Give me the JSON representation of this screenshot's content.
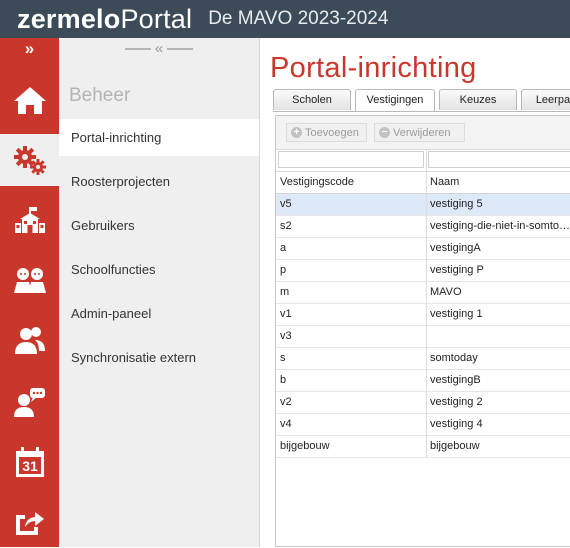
{
  "header": {
    "brand_bold": "zermelo",
    "brand_light": "Portal",
    "school": "De MAVO 2023-2024"
  },
  "rail": {
    "expand_label": "»",
    "calendar_day": "31",
    "items": [
      "home-icon",
      "gears-icon",
      "school-icon",
      "students-icon",
      "users-icon",
      "chat-person-icon",
      "calendar-icon",
      "share-icon"
    ]
  },
  "nav": {
    "collapse_label": "«",
    "heading": "Beheer",
    "items": [
      {
        "label": "Portal-inrichting"
      },
      {
        "label": "Roosterprojecten"
      },
      {
        "label": "Gebruikers"
      },
      {
        "label": "Schoolfuncties"
      },
      {
        "label": "Admin-paneel"
      },
      {
        "label": "Synchronisatie extern"
      }
    ]
  },
  "main": {
    "title": "Portal-inrichting",
    "tabs": [
      {
        "label": "Scholen"
      },
      {
        "label": "Vestigingen"
      },
      {
        "label": "Keuzes"
      },
      {
        "label": "Leerpad"
      }
    ],
    "toolbar": {
      "add_label": "Toevoegen",
      "remove_label": "Verwijderen"
    },
    "table": {
      "columns": [
        "Vestigingscode",
        "Naam"
      ],
      "rows": [
        {
          "code": "v5",
          "name": "vestiging 5"
        },
        {
          "code": "s2",
          "name": "vestiging-die-niet-in-somtoday-staat"
        },
        {
          "code": "a",
          "name": "vestigingA"
        },
        {
          "code": "p",
          "name": "vestiging P"
        },
        {
          "code": "m",
          "name": "MAVO"
        },
        {
          "code": "v1",
          "name": "vestiging 1"
        },
        {
          "code": "v3",
          "name": ""
        },
        {
          "code": "s",
          "name": "somtoday"
        },
        {
          "code": "b",
          "name": "vestigingB"
        },
        {
          "code": "v2",
          "name": "vestiging 2"
        },
        {
          "code": "v4",
          "name": "vestiging 4"
        },
        {
          "code": "bijgebouw",
          "name": "bijgebouw"
        }
      ]
    }
  },
  "colors": {
    "accent_red": "#c9372c",
    "header_bg": "#3d4a58",
    "nav_bg": "#efefef",
    "selected_row": "#dde8f8"
  }
}
